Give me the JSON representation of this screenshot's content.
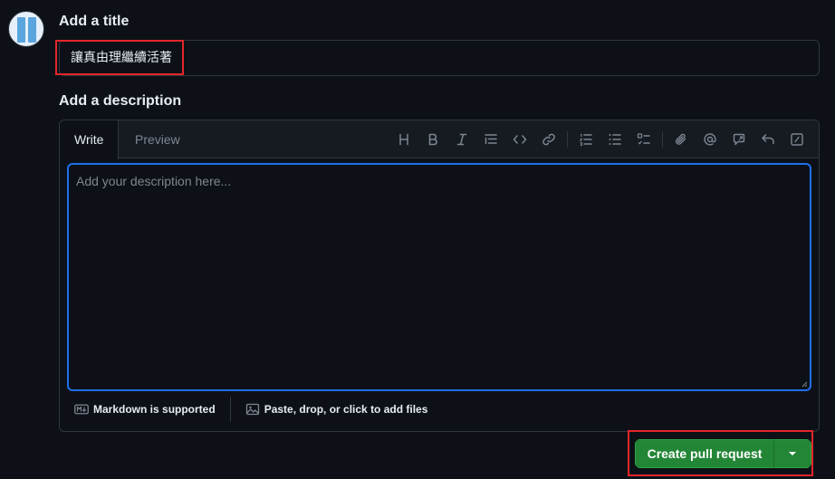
{
  "title_section": {
    "label": "Add a title",
    "value": "讓真由理繼續活著"
  },
  "description_section": {
    "label": "Add a description",
    "tabs": [
      {
        "label": "Write",
        "active": true
      },
      {
        "label": "Preview",
        "active": false
      }
    ],
    "toolbar_icons": [
      "heading-icon",
      "bold-icon",
      "italic-icon",
      "quote-icon",
      "code-icon",
      "link-icon",
      "numbered-list-icon",
      "bulleted-list-icon",
      "task-list-icon",
      "attach-icon",
      "mention-icon",
      "reference-icon",
      "undo-icon",
      "slash-commands-icon"
    ],
    "placeholder": "Add your description here...",
    "footer": {
      "markdown_label": "Markdown is supported",
      "files_label": "Paste, drop, or click to add files"
    }
  },
  "actions": {
    "create_label": "Create pull request"
  },
  "colors": {
    "background": "#0d1117",
    "accent_focus": "#1f6feb",
    "primary_button": "#238636",
    "highlight_box": "#e5252a"
  }
}
